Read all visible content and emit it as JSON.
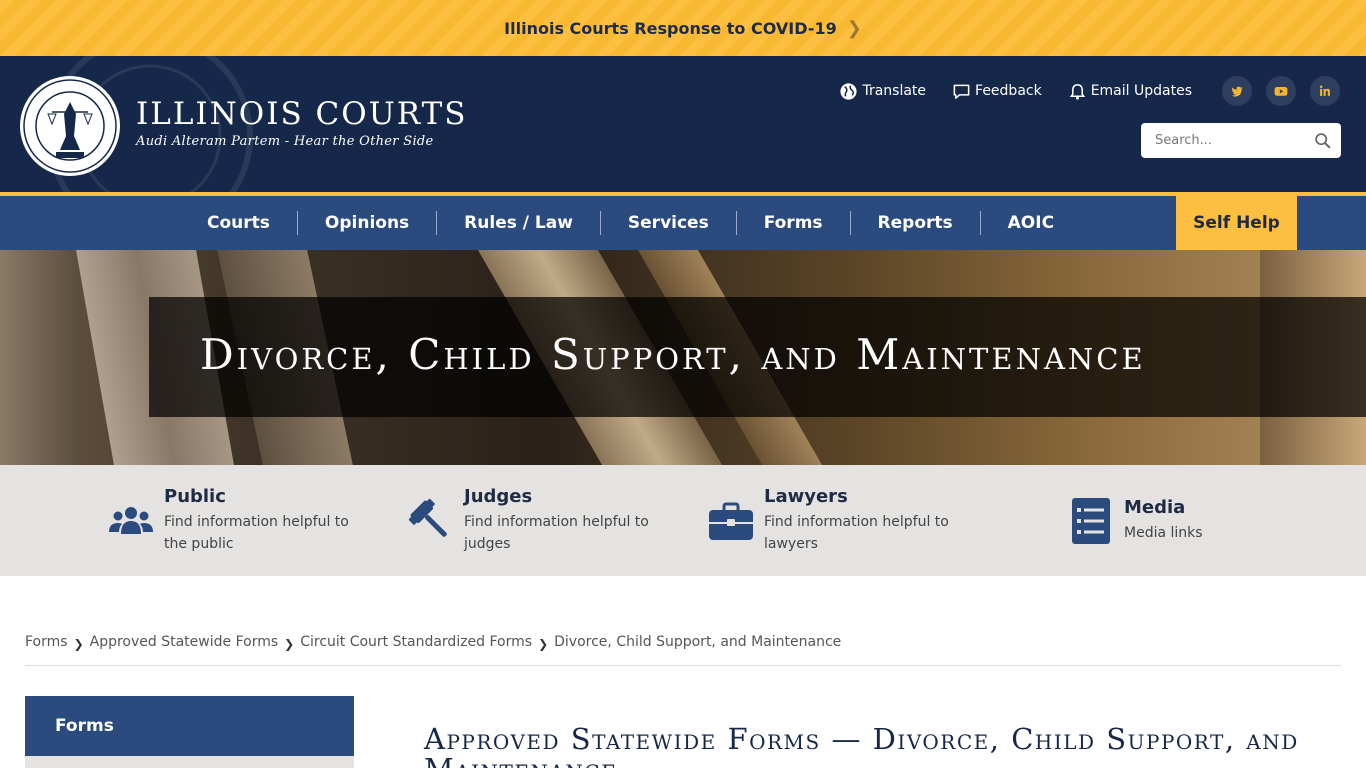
{
  "covid": {
    "label": "Illinois Courts Response to COVID-19"
  },
  "brand": {
    "title": "ILLINOIS COURTS",
    "subtitle": "Audi Alteram Partem - Hear the Other Side"
  },
  "utility": {
    "translate": "Translate",
    "feedback": "Feedback",
    "email_updates": "Email Updates",
    "socials": [
      "twitter-icon",
      "youtube-icon",
      "linkedin-icon"
    ]
  },
  "search": {
    "placeholder": "Search..."
  },
  "nav": {
    "items": [
      "Courts",
      "Opinions",
      "Rules / Law",
      "Services",
      "Forms",
      "Reports",
      "AOIC"
    ],
    "self_help": "Self Help"
  },
  "hero": {
    "title": "Divorce, Child Support, and Maintenance"
  },
  "audiences": [
    {
      "title": "Public",
      "desc": "Find information helpful to the public",
      "icon": "users-icon"
    },
    {
      "title": "Judges",
      "desc": "Find information helpful to judges",
      "icon": "gavel-icon"
    },
    {
      "title": "Lawyers",
      "desc": "Find information helpful to lawyers",
      "icon": "briefcase-icon"
    },
    {
      "title": "Media",
      "desc": "Media links",
      "icon": "list-icon"
    }
  ],
  "breadcrumb": {
    "items": [
      "Forms",
      "Approved Statewide Forms",
      "Circuit Court Standardized Forms"
    ],
    "current": "Divorce, Child Support, and Maintenance"
  },
  "sidebar": {
    "heading": "Forms"
  },
  "page": {
    "heading": "Approved Statewide Forms — Divorce, Child Support, and Maintenance"
  },
  "colors": {
    "navy": "#16284a",
    "blue": "#2b4b7e",
    "gold": "#fdbf3f",
    "gray": "#e5e3e1"
  }
}
